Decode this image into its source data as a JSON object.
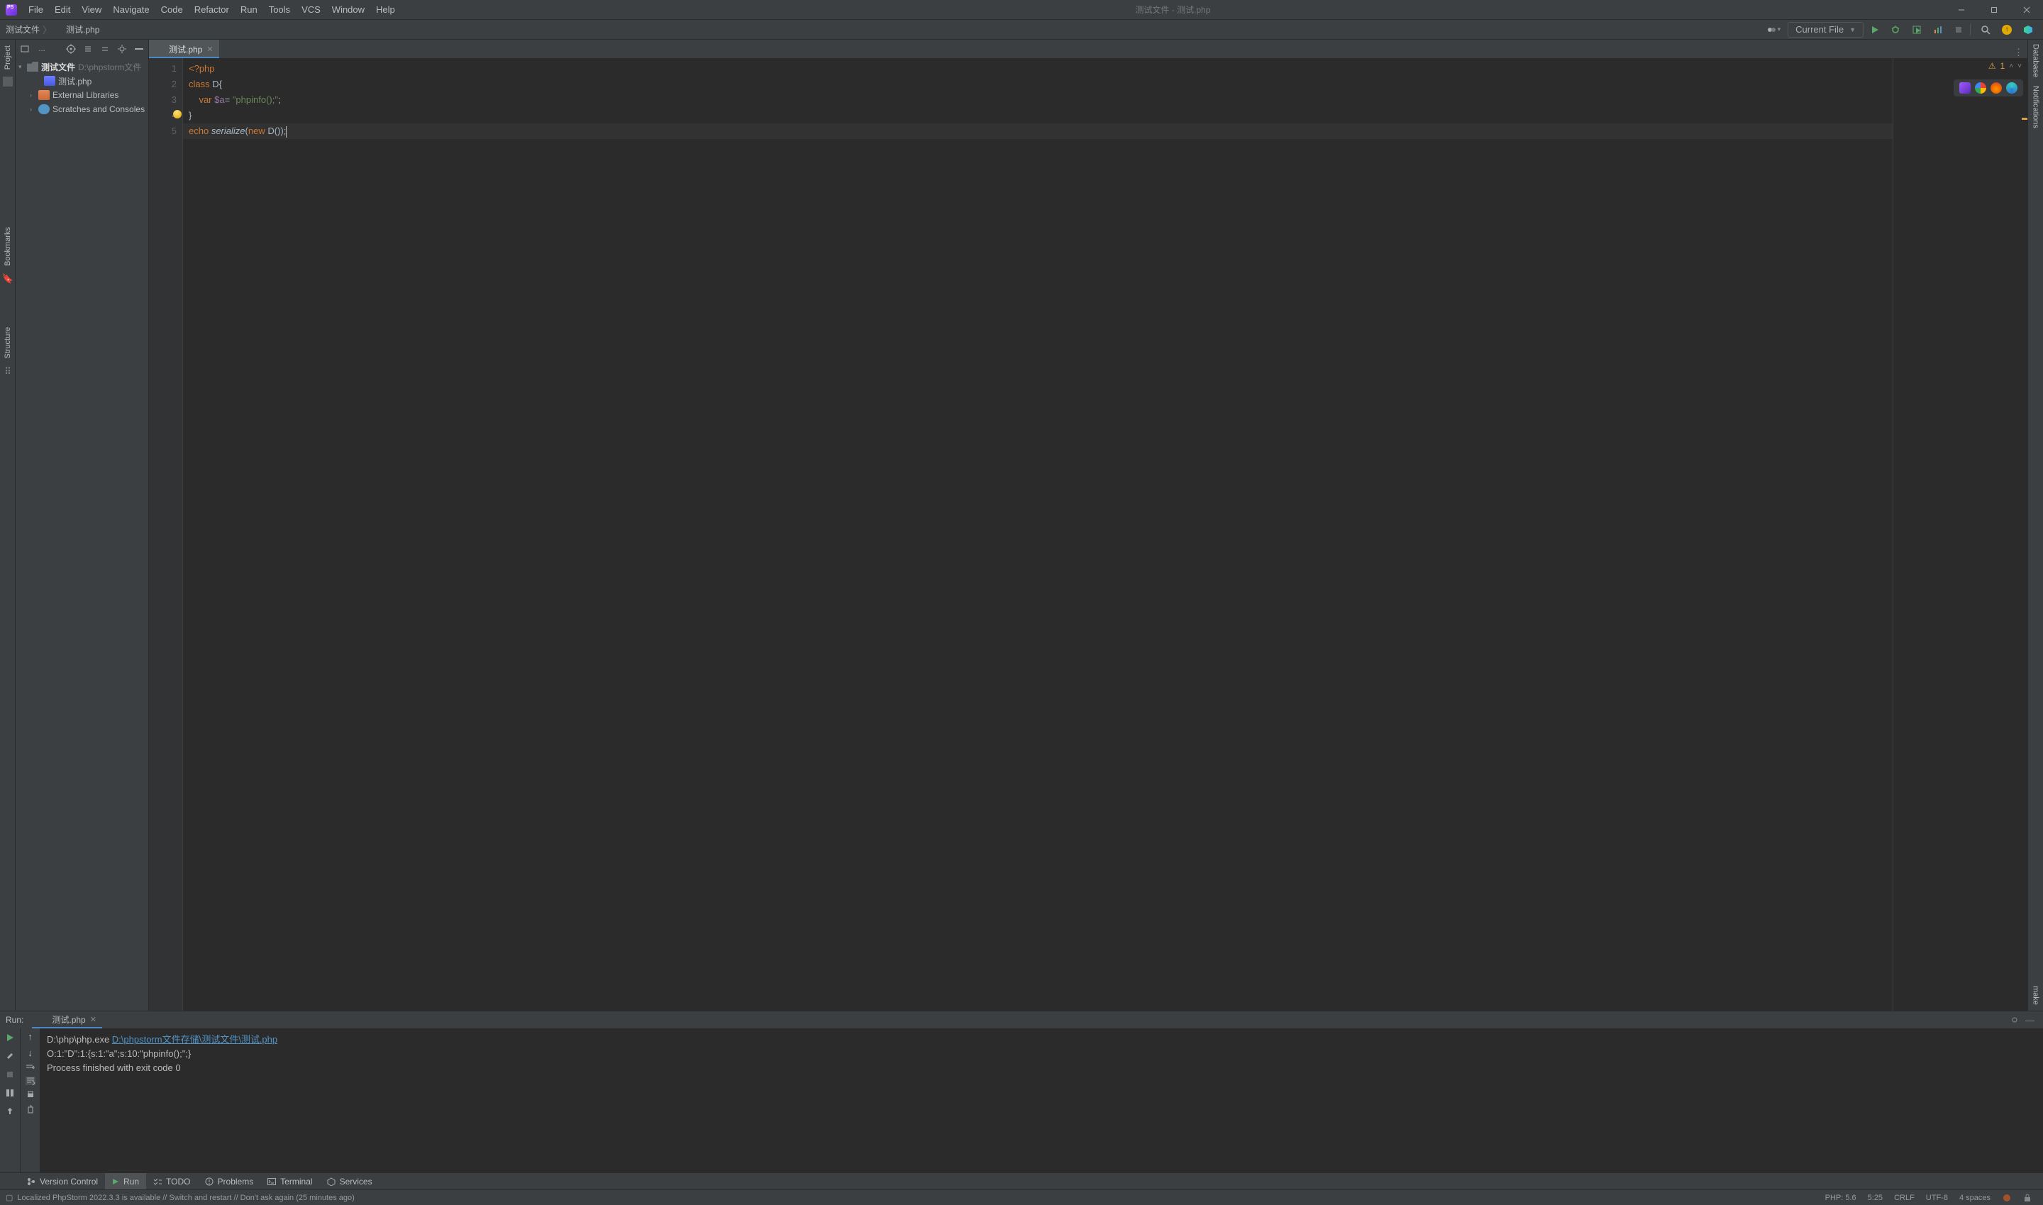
{
  "window": {
    "title": "测试文件 - 测试.php"
  },
  "menu": [
    "File",
    "Edit",
    "View",
    "Navigate",
    "Code",
    "Refactor",
    "Run",
    "Tools",
    "VCS",
    "Window",
    "Help"
  ],
  "breadcrumb": {
    "root": "测试文件",
    "file": "测试.php"
  },
  "toolbar": {
    "runconfig": "Current File"
  },
  "left_tabs": {
    "project": "Project"
  },
  "project_tree": {
    "root_name": "测试文件",
    "root_path": "D:\\phpstorm文件",
    "file1": "测试.php",
    "ext_lib": "External Libraries",
    "scratches": "Scratches and Consoles"
  },
  "editor_tab": {
    "name": "测试.php"
  },
  "code": {
    "l1_open": "<?php",
    "l2_class": "class",
    "l2_name": " D{",
    "l3_var": "var",
    "l3_varname": " $a",
    "l3_eq": "= ",
    "l3_str": "\"phpinfo();\"",
    "l3_semi": ";",
    "l4": "}",
    "l5_echo": "echo",
    "l5_sp": " ",
    "l5_fn": "serialize",
    "l5_open": "(",
    "l5_new": "new",
    "l5_cls": " D()",
    "l5_close": ");"
  },
  "inspections": {
    "warn_count": "1"
  },
  "right_tabs": {
    "database": "Database",
    "notifications": "Notifications",
    "make": "make"
  },
  "left_tools": {
    "bookmarks": "Bookmarks",
    "structure": "Structure"
  },
  "run": {
    "label": "Run:",
    "tab": "测试.php",
    "cmd_prefix": "D:\\php\\php.exe ",
    "cmd_link": "D:\\phpstorm文件存储\\测试文件\\测试.php",
    "output": "O:1:\"D\":1:{s:1:\"a\";s:10:\"phpinfo();\";}",
    "exit": "Process finished with exit code 0"
  },
  "bottom": {
    "version_control": "Version Control",
    "run": "Run",
    "todo": "TODO",
    "problems": "Problems",
    "terminal": "Terminal",
    "services": "Services"
  },
  "status": {
    "message": "Localized PhpStorm 2022.3.3 is available // Switch and restart // Don't ask again (25 minutes ago)",
    "php": "PHP: 5.6",
    "pos": "5:25",
    "le": "CRLF",
    "enc": "UTF-8",
    "indent": "4 spaces"
  }
}
